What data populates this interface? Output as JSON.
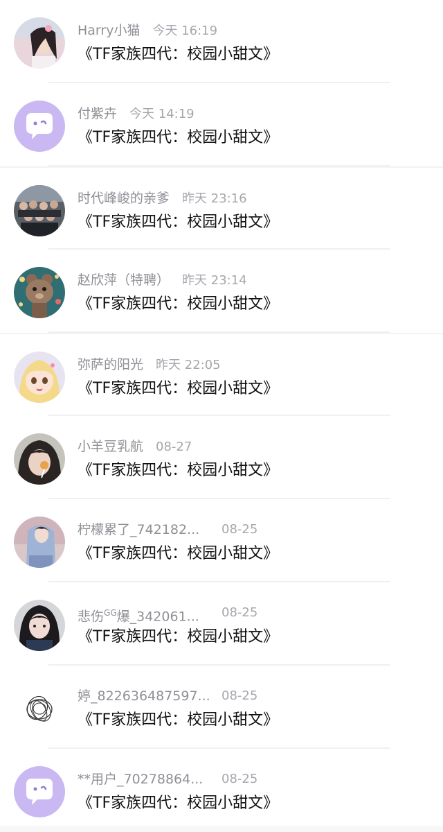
{
  "conversations": [
    {
      "name": "Harry小猫",
      "time": "今天 16:19",
      "message": "《TF家族四代：校园小甜文》",
      "avatar": "photo-girl-pink"
    },
    {
      "name": "付紫卉",
      "time": "今天 14:19",
      "message": "《TF家族四代：校园小甜文》",
      "avatar": "default-chat-bubble"
    },
    {
      "name": "时代峰峻的亲爹",
      "time": "昨天 23:16",
      "message": "《TF家族四代：校园小甜文》",
      "avatar": "photo-group"
    },
    {
      "name": "赵欣萍（特聘）",
      "time": "昨天 23:14",
      "message": "《TF家族四代：校园小甜文》",
      "avatar": "photo-bear"
    },
    {
      "name": "弥萨的阳光",
      "time": "昨天 22:05",
      "message": "《TF家族四代：校园小甜文》",
      "avatar": "photo-anime-girl"
    },
    {
      "name": "小羊豆乳航",
      "time": "08-27",
      "message": "《TF家族四代：校园小甜文》",
      "avatar": "photo-girl-lollipop"
    },
    {
      "name": "柠檬累了_742182...",
      "time": "08-25",
      "message": "《TF家族四代：校园小甜文》",
      "avatar": "photo-girl-blue"
    },
    {
      "name_main": "悲伤",
      "name_sup": "GG",
      "name_rest": "爆_342061...",
      "time": "08-25",
      "message": "《TF家族四代：校园小甜文》",
      "avatar": "photo-girl-dark"
    },
    {
      "name": "婷_822636487597...",
      "time": "08-25",
      "message": "《TF家族四代：校园小甜文》",
      "avatar": "scribble"
    },
    {
      "name": "**用户_70278864...",
      "time": "08-25",
      "message": "《TF家族四代：校园小甜文》",
      "avatar": "default-chat-bubble"
    }
  ],
  "colors": {
    "default_avatar_bg": "#c9b8f2",
    "name_text": "#8f8f96",
    "time_text": "#a6a6ad",
    "message_text": "#111111"
  }
}
